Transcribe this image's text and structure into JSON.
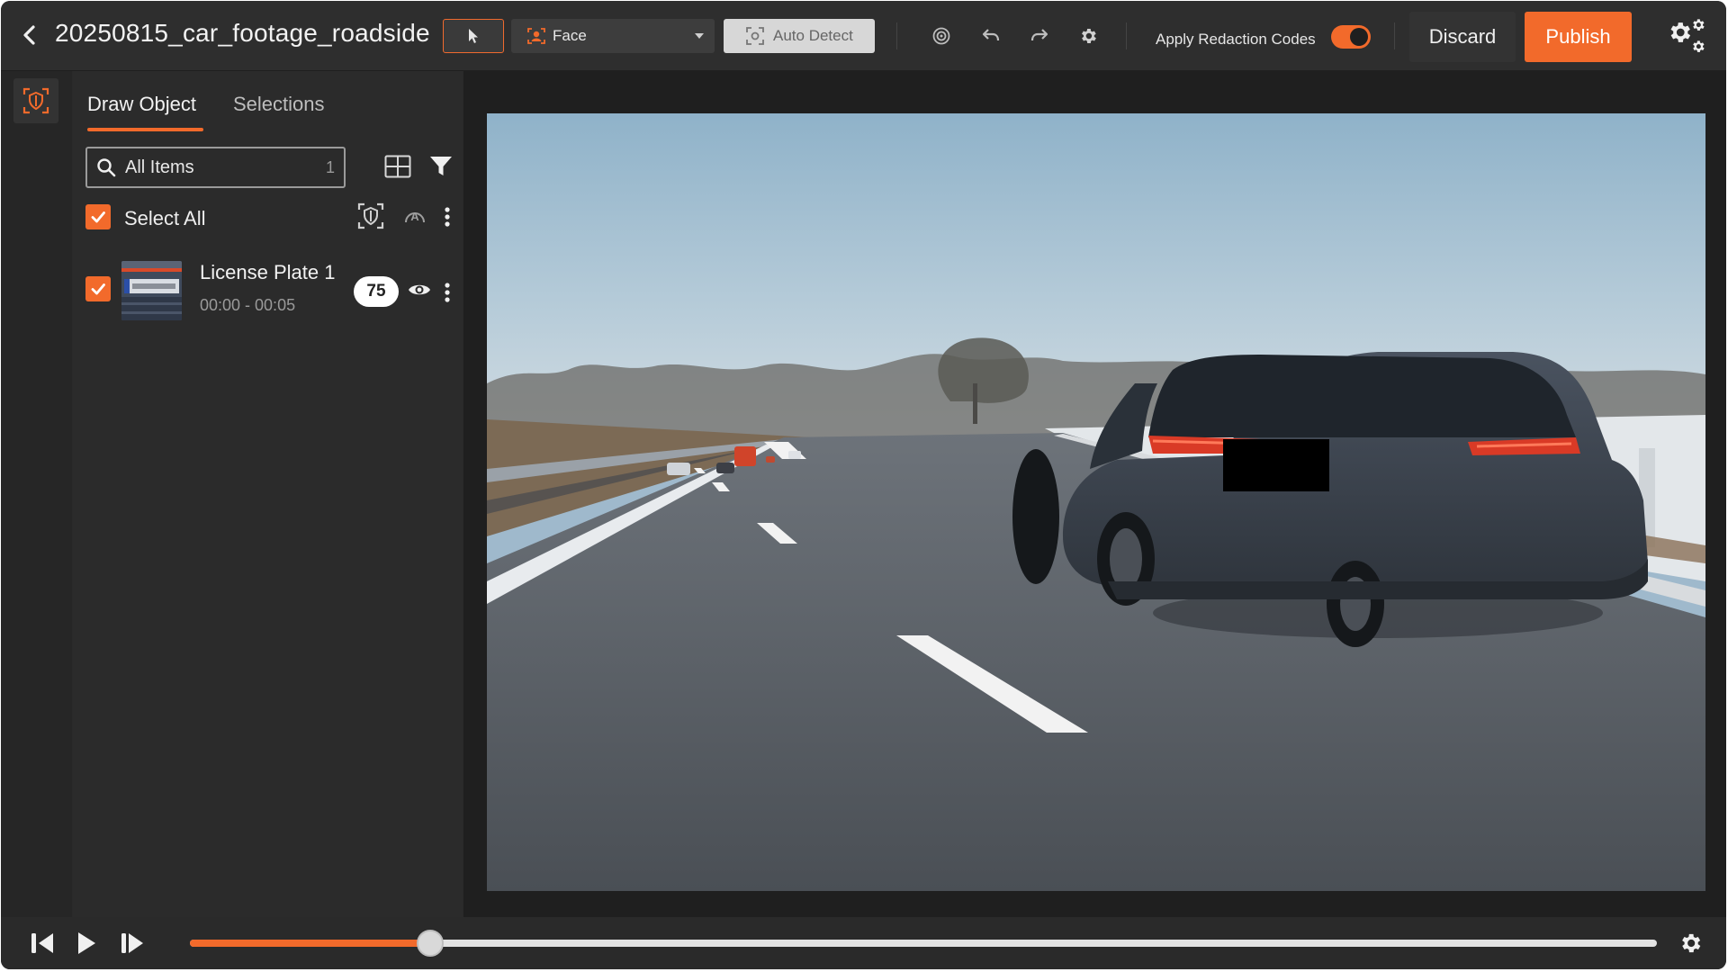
{
  "header": {
    "title": "20250815_car_footage_roadside",
    "detection_type": "Face",
    "auto_detect_label": "Auto Detect",
    "apply_redaction_label": "Apply Redaction Codes",
    "apply_redaction_enabled": true,
    "discard_label": "Discard",
    "publish_label": "Publish"
  },
  "panel": {
    "tabs": [
      {
        "label": "Draw Object",
        "active": true
      },
      {
        "label": "Selections",
        "active": false
      }
    ],
    "search": {
      "text": "All Items",
      "count": "1"
    },
    "select_all_label": "Select All",
    "items": [
      {
        "name": "License Plate 1",
        "time_range": "00:00 - 00:05",
        "badge": "75",
        "checked": true
      }
    ]
  },
  "playback": {
    "progress": 0.164
  },
  "colors": {
    "accent": "#f26a2b",
    "background": "#2a2a2a"
  },
  "icons": {
    "back": "chevron-left-icon",
    "select": "cursor-icon",
    "face": "face-detect-icon",
    "auto_detect": "scan-icon",
    "target": "target-icon",
    "undo": "undo-icon",
    "redo": "redo-icon",
    "settings": "gear-icon",
    "gears": "gears-icon",
    "redaction": "shield-redact-icon",
    "grid": "grid-view-icon",
    "filter": "filter-icon",
    "auto_label": "auto-a-icon",
    "more": "more-vertical-icon",
    "eye": "eye-icon",
    "prev": "step-back-icon",
    "play": "play-icon",
    "next": "step-forward-icon"
  }
}
